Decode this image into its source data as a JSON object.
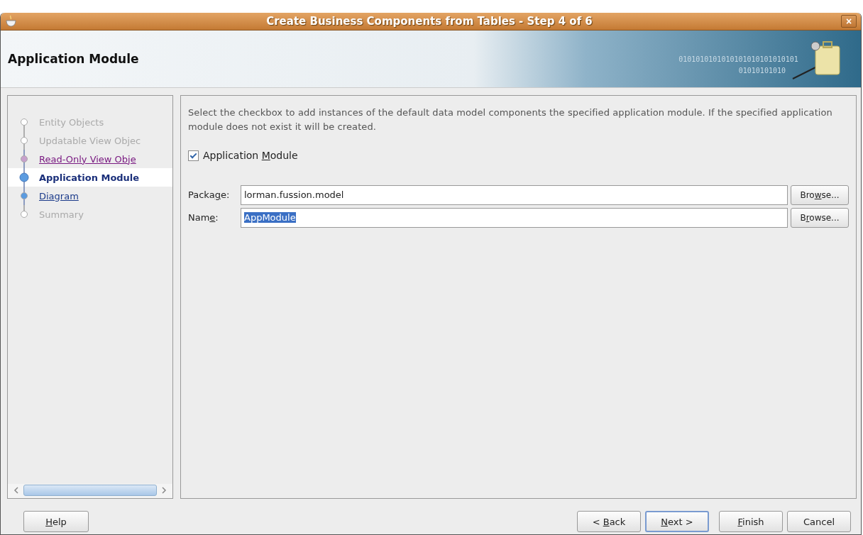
{
  "window": {
    "title": "Create Business Components from Tables - Step 4 of 6",
    "close": "×"
  },
  "header": {
    "title": "Application Module",
    "banner_digits": [
      "0101010101010101010101010101",
      "01010101010"
    ]
  },
  "steps": [
    {
      "label": "Entity Objects",
      "kind": "disabled",
      "selected": false
    },
    {
      "label": "Updatable View Objec",
      "kind": "disabled",
      "selected": false
    },
    {
      "label": "Read-Only View Obje",
      "kind": "visited",
      "selected": false
    },
    {
      "label": "Application Module",
      "kind": "current",
      "selected": true
    },
    {
      "label": "Diagram",
      "kind": "link",
      "selected": false
    },
    {
      "label": "Summary",
      "kind": "disabled",
      "selected": false
    }
  ],
  "content": {
    "description": "Select the checkbox to add instances of the default data model components the specified application module.  If the specified application module does not exist it will be created.",
    "checkbox": {
      "label": {
        "pre": "Application ",
        "key": "M",
        "post": "odule"
      },
      "checked": true
    },
    "fields": [
      {
        "label": {
          "pre": "Packa",
          "key": "g",
          "post": "e:"
        },
        "value": "lorman.fussion.model",
        "value_selected": false,
        "button": {
          "pre": "Bro",
          "key": "w",
          "post": "se..."
        }
      },
      {
        "label": {
          "pre": "Nam",
          "key": "e",
          "post": ":"
        },
        "value": "AppModule",
        "value_selected": true,
        "button": {
          "pre": "B",
          "key": "r",
          "post": "owse..."
        }
      }
    ]
  },
  "buttons": {
    "help": {
      "key": "H",
      "post": "elp"
    },
    "nav": [
      {
        "label": {
          "pre": "< ",
          "key": "B",
          "post": "ack"
        },
        "default": false
      },
      {
        "label": {
          "key": "N",
          "post": "ext >"
        },
        "default": true
      },
      {
        "label": {
          "key": "F",
          "post": "inish"
        },
        "default": false
      },
      {
        "label": {
          "pre": "Cancel"
        },
        "default": false
      }
    ]
  }
}
